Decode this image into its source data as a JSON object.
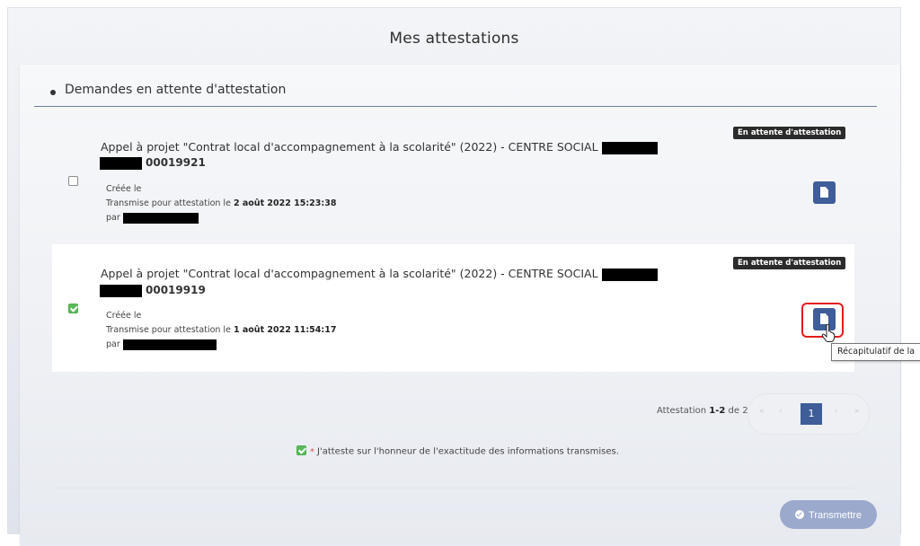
{
  "page": {
    "title": "Mes attestations"
  },
  "section": {
    "title": "Demandes en attente d'attestation"
  },
  "requests": [
    {
      "title": "Appel à projet \"Contrat local d'accompagnement à la scolarité\" (2022) - CENTRE SOCIAL",
      "number": "00019921",
      "checked": false,
      "status": "En attente d'attestation",
      "created_label": "Créée le",
      "transmitted_prefix": "Transmise pour attestation le",
      "transmitted_date": "2 août 2022 15:23:38",
      "by_label": "par"
    },
    {
      "title": "Appel à projet \"Contrat local d'accompagnement à la scolarité\" (2022) - CENTRE SOCIAL",
      "number": "00019919",
      "checked": true,
      "status": "En attente d'attestation",
      "created_label": "Créée le",
      "transmitted_prefix": "Transmise pour attestation le",
      "transmitted_date": "1 août 2022 11:54:17",
      "by_label": "par"
    }
  ],
  "tooltip": "Récapitulatif de la",
  "pagination": {
    "label_prefix": "Attestation",
    "range": "1-2",
    "label_of": "de 2",
    "first": "«",
    "prev": "‹",
    "current": "1",
    "next": "›",
    "last": "»"
  },
  "attestation": {
    "required_mark": "*",
    "text": "J'atteste sur l'honneur de l'exactitude des informations transmises."
  },
  "actions": {
    "submit_label": "Transmettre"
  },
  "colors": {
    "primary": "#3e5d99",
    "badge": "#2b2b2b",
    "check": "#5cb85c",
    "highlight": "#e21b1b",
    "submit_disabled": "#9aa9cc"
  }
}
